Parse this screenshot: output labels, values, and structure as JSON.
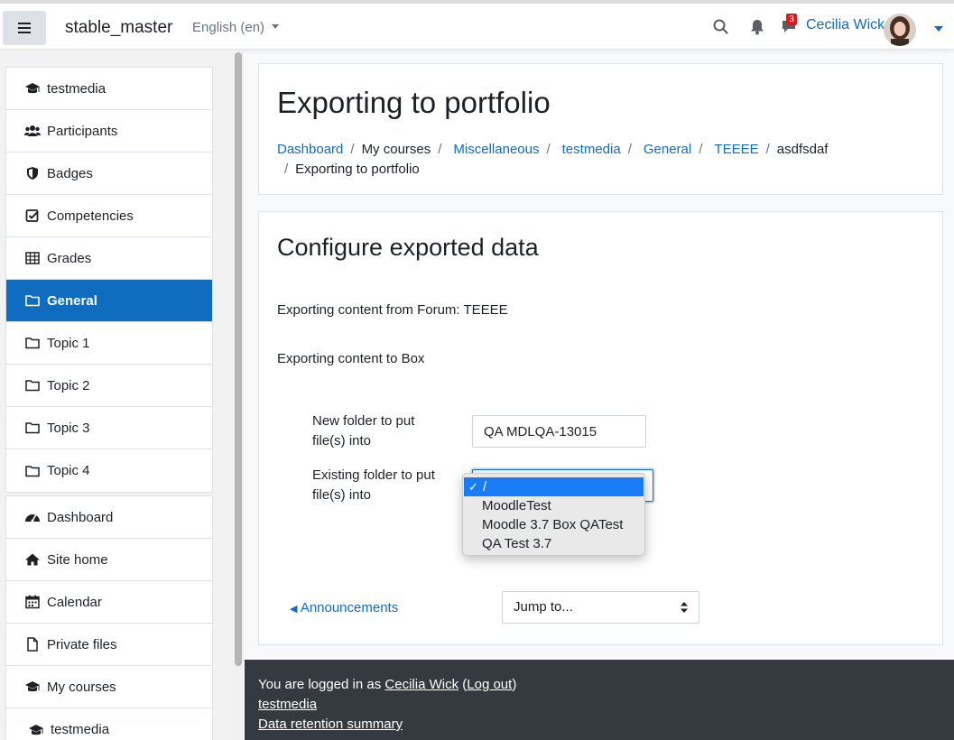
{
  "navbar": {
    "site_name": "stable_master",
    "language": "English (en)",
    "message_count": "3",
    "user_name": "Cecilia Wick"
  },
  "drawer": {
    "course_items": [
      {
        "label": "testmedia",
        "icon": "graduation-cap-icon"
      },
      {
        "label": "Participants",
        "icon": "users-icon"
      },
      {
        "label": "Badges",
        "icon": "shield-icon"
      },
      {
        "label": "Competencies",
        "icon": "check-square-icon"
      },
      {
        "label": "Grades",
        "icon": "table-icon"
      },
      {
        "label": "General",
        "icon": "folder-icon",
        "active": true
      },
      {
        "label": "Topic 1",
        "icon": "folder-icon"
      },
      {
        "label": "Topic 2",
        "icon": "folder-icon"
      },
      {
        "label": "Topic 3",
        "icon": "folder-icon"
      },
      {
        "label": "Topic 4",
        "icon": "folder-icon"
      }
    ],
    "site_items": [
      {
        "label": "Dashboard",
        "icon": "dashboard-icon"
      },
      {
        "label": "Site home",
        "icon": "home-icon"
      },
      {
        "label": "Calendar",
        "icon": "calendar-icon"
      },
      {
        "label": "Private files",
        "icon": "file-icon"
      },
      {
        "label": "My courses",
        "icon": "graduation-cap-icon"
      },
      {
        "label": "testmedia",
        "icon": "graduation-cap-icon"
      }
    ]
  },
  "header": {
    "title": "Exporting to portfolio",
    "breadcrumb": {
      "dashboard": "Dashboard",
      "my_courses": "My courses",
      "miscellaneous": "Miscellaneous",
      "testmedia": "testmedia",
      "general": "General",
      "teeee": "TEEEE",
      "asdfsdaf": "asdfsdaf",
      "current": "Exporting to portfolio"
    }
  },
  "main": {
    "section_title": "Configure exported data",
    "exporting_from": "Exporting content from Forum: TEEEE",
    "exporting_to": "Exporting content to Box",
    "new_folder_label": "New folder to put file(s) into",
    "new_folder_value": "QA MDLQA-13015",
    "existing_folder_label": "Existing folder to put file(s) into",
    "existing_folder_options": [
      "/",
      "MoodleTest",
      "Moodle 3.7 Box QATest",
      "QA Test 3.7"
    ],
    "existing_folder_selected": "/",
    "prev_activity": "Announcements",
    "jump_to": "Jump to..."
  },
  "footer": {
    "logged_in_prefix": "You are logged in as",
    "user_link": "Cecilia Wick",
    "logout": "Log out",
    "course_link": "testmedia",
    "data_retention": "Data retention summary"
  },
  "colors": {
    "primary": "#0f6cbf",
    "footer_bg": "#343a40",
    "badge_red": "#e0171e",
    "select_highlight": "#1a7cf5"
  }
}
